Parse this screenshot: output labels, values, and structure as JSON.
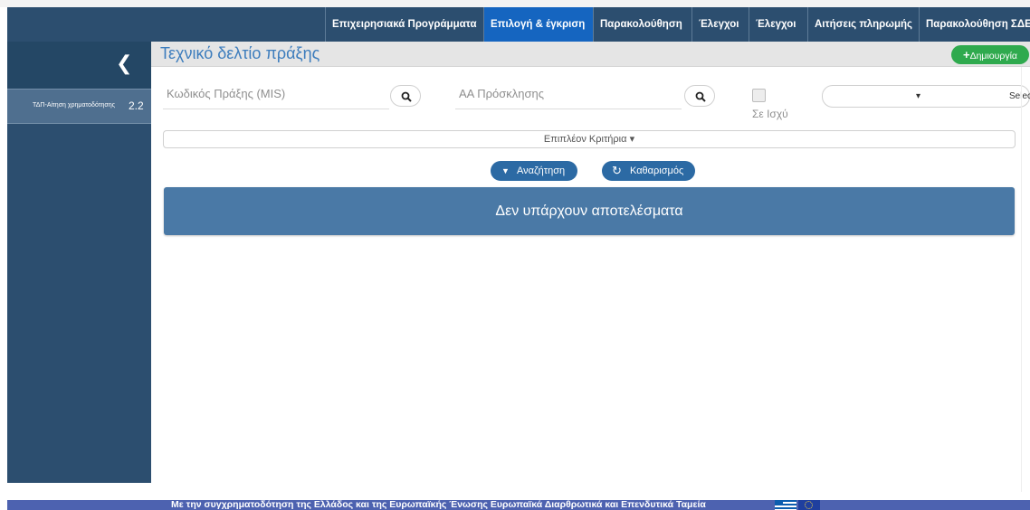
{
  "nav": {
    "items": [
      {
        "label": "Επιχειρησιακά Προγράμματα",
        "active": false
      },
      {
        "label": "Επιλογή & έγκριση",
        "active": true
      },
      {
        "label": "Παρακολούθηση",
        "active": false
      },
      {
        "label": "Έλεγχοι",
        "active": false
      },
      {
        "label": "Έλεγχοι",
        "active": false
      },
      {
        "label": "Αιτήσεις πληρωμής",
        "active": false
      },
      {
        "label": "Παρακολούθηση ΣΔΕ",
        "active": false
      }
    ]
  },
  "sidebar": {
    "collapse_icon": "chevron-left-icon",
    "items": [
      {
        "label": "ΤΔΠ-Αίτηση χρηματοδότησης",
        "number": "2.2"
      }
    ]
  },
  "header": {
    "title": "Τεχνικό δελτίο πράξης",
    "create_label": "Δημιουργία",
    "create_icon": "plus-icon"
  },
  "filters": {
    "mis_label": "Κωδικός Πράξης (MIS)",
    "call_label": "ΑΑ Πρόσκλησης",
    "active_label": "Σε Ισχύ",
    "active_checked": false,
    "select_label": "Select"
  },
  "criteria_label": "Επιπλέον Κριτήρια",
  "actions": {
    "search_label": "Αναζήτηση",
    "clear_label": "Καθαρισμός"
  },
  "results": {
    "empty_message": "Δεν υπάρχουν αποτελέσματα"
  },
  "footer": {
    "text": "Με την συγχρηματοδότηση της Ελλάδος και της Ευρωπαϊκής Ένωσης Ευρωπαϊκά Διαρθρωτικά και Επενδυτικά Ταμεία"
  },
  "colors": {
    "nav_bg": "#2c4e6f",
    "nav_active": "#1565c0",
    "title_text": "#3d7dbd",
    "create_green": "#2faa4e",
    "action_blue": "#2c6aa4",
    "results_bg": "#4a79a6",
    "footer_bg": "#4d62b0"
  }
}
